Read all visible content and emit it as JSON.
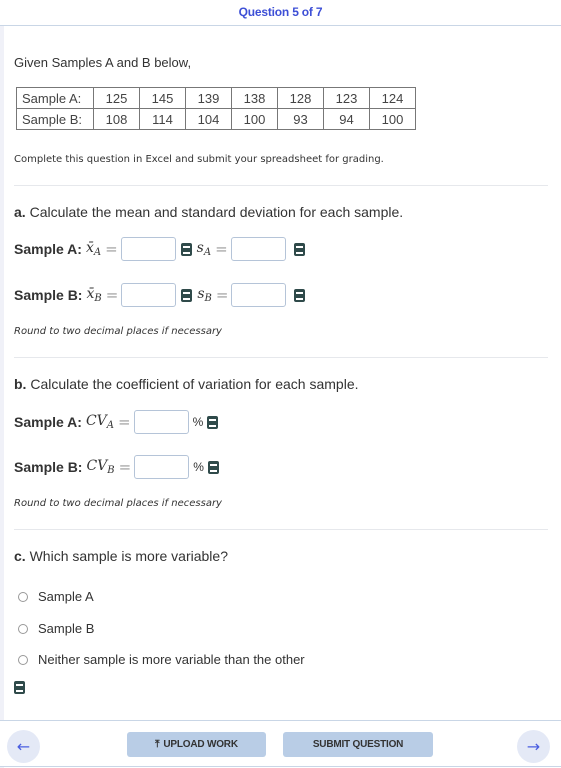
{
  "header": {
    "question_counter": "Question 5 of 7"
  },
  "intro": "Given Samples A and B below,",
  "samples_table": {
    "rows": [
      {
        "label": "Sample A:",
        "values": [
          "125",
          "145",
          "139",
          "138",
          "128",
          "123",
          "124"
        ]
      },
      {
        "label": "Sample B:",
        "values": [
          "108",
          "114",
          "104",
          "100",
          "93",
          "94",
          "100"
        ]
      }
    ]
  },
  "excel_note": "Complete this question in Excel and submit your spreadsheet for grading.",
  "part_a": {
    "letter": "a.",
    "title": "Calculate the mean and standard deviation for each sample.",
    "rows": [
      {
        "label": "Sample A:",
        "mean_symbol": "x̄",
        "mean_sub": "A",
        "sd_symbol": "s",
        "sd_sub": "A",
        "mean_value": "",
        "sd_value": ""
      },
      {
        "label": "Sample B:",
        "mean_symbol": "x̄",
        "mean_sub": "B",
        "sd_symbol": "s",
        "sd_sub": "B",
        "mean_value": "",
        "sd_value": ""
      }
    ],
    "equals": "=",
    "note": "Round to two decimal places if necessary"
  },
  "part_b": {
    "letter": "b.",
    "title": "Calculate the coefficient of variation for each sample.",
    "rows": [
      {
        "label": "Sample A:",
        "symbol": "CV",
        "sub": "A",
        "value": "",
        "unit": "%"
      },
      {
        "label": "Sample B:",
        "symbol": "CV",
        "sub": "B",
        "value": "",
        "unit": "%"
      }
    ],
    "equals": "=",
    "note": "Round to two decimal places if necessary"
  },
  "part_c": {
    "letter": "c.",
    "title": "Which sample is more variable?",
    "options": [
      "Sample A",
      "Sample B",
      "Neither sample is more variable than the other"
    ],
    "selected": null
  },
  "footer": {
    "prev_icon": "←",
    "next_icon": "→",
    "upload_icon": "⤒",
    "upload_label": "UPLOAD WORK",
    "submit_label": "SUBMIT QUESTION"
  },
  "colors": {
    "accent": "#3d4fd6",
    "button_bg": "#b9cde6",
    "nav_bg": "#e4e9f6",
    "book_icon": "#2f4a4a"
  }
}
